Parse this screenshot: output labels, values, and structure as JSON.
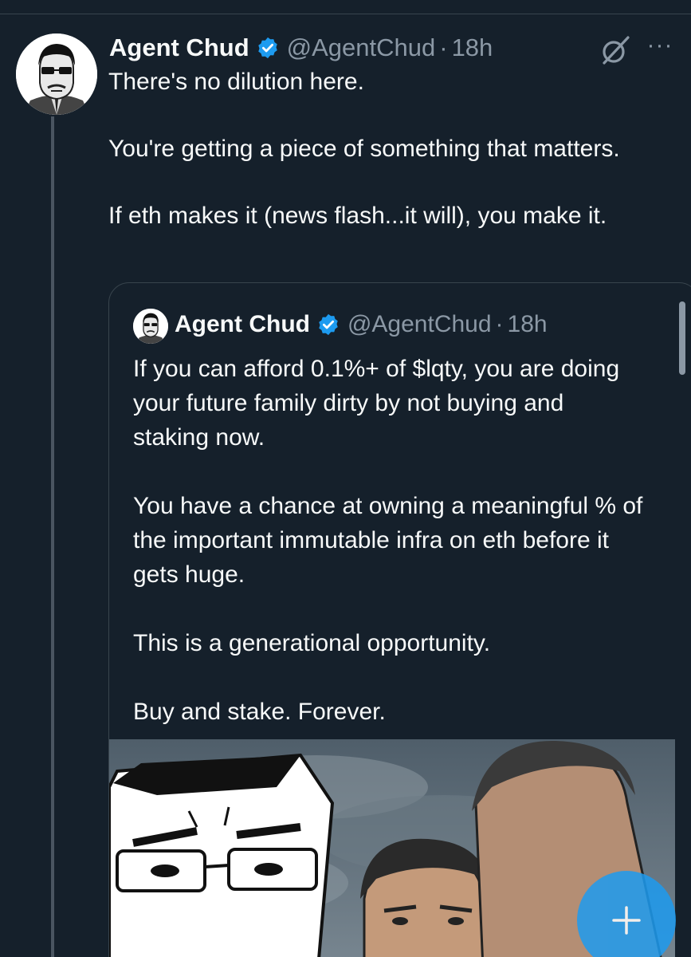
{
  "tweet": {
    "author_name": "Agent Chud",
    "handle": "@AgentChud",
    "separator": "·",
    "time": "18h",
    "paragraphs": [
      "There's no dilution here.",
      "You're getting a piece of something that matters.",
      "If eth makes it (news flash...it will), you make it."
    ],
    "more_label": "···"
  },
  "quote": {
    "author_name": "Agent Chud",
    "handle": "@AgentChud",
    "separator": "·",
    "time": "18h",
    "paragraphs": [
      "If you can afford 0.1%+ of $lqty, you are doing your future family dirty by not buying and staking now.",
      "You have a chance at owning a meaningful % of the important immutable infra on eth before it gets huge.",
      "This is a generational opportunity.",
      "Buy and stake.  Forever."
    ]
  },
  "icons": {
    "verified": "verified-badge-icon",
    "grok": "grok-icon",
    "more": "more-icon",
    "compose": "plus-icon"
  },
  "colors": {
    "background": "#15202b",
    "text": "#f7f9f9",
    "secondary": "#8b98a5",
    "border": "#38444d",
    "accent": "#1d9bf0"
  }
}
